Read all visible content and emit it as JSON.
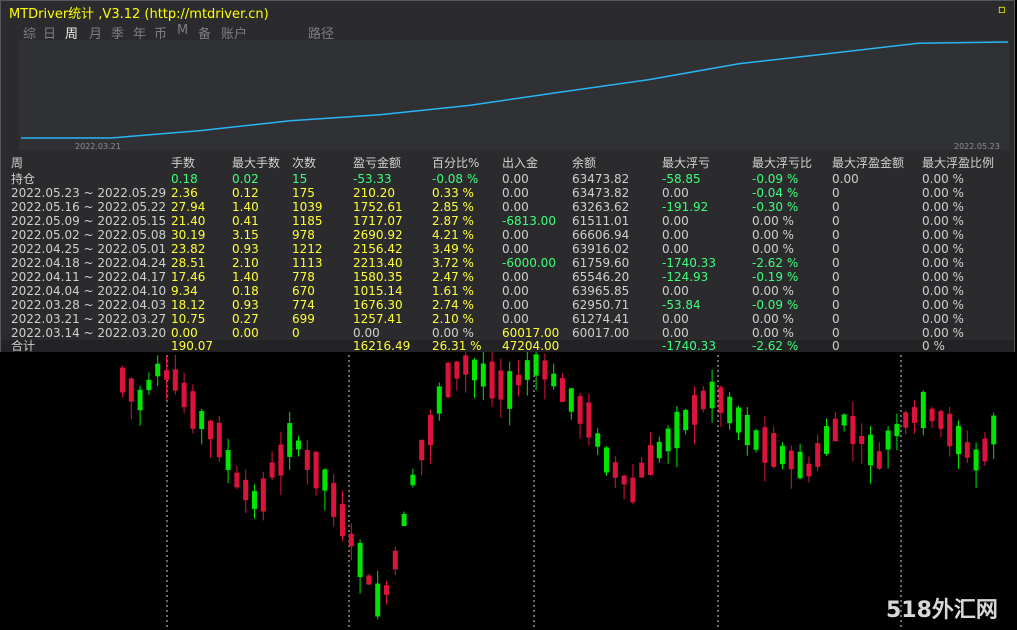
{
  "window": {
    "title": "MTDriver统计 ,V3.12 (http://mtdriver.cn)",
    "title_color": "#ffff00"
  },
  "tabs": [
    {
      "label": "综",
      "active": false
    },
    {
      "label": "日",
      "active": false
    },
    {
      "label": "周",
      "active": true
    },
    {
      "label": "月",
      "active": false
    },
    {
      "label": "季",
      "active": false
    },
    {
      "label": "年",
      "active": false
    },
    {
      "label": "币",
      "active": false
    },
    {
      "label": "M",
      "active": false
    },
    {
      "label": "备",
      "active": false
    },
    {
      "label": "账户",
      "active": false
    },
    {
      "label": "路径",
      "active": false
    }
  ],
  "equity_chart": {
    "start_date": "2022.03.21",
    "end_date": "2022.05.23",
    "line_color": "#29b6f6"
  },
  "table": {
    "headers": [
      "周",
      "手数",
      "最大手数",
      "次数",
      "盈亏金额",
      "百分比%",
      "出入金",
      "余额",
      "最大浮亏",
      "最大浮亏比",
      "最大浮盈金额",
      "最大浮盈比例"
    ],
    "rows": [
      [
        "持仓",
        "0.18",
        "0.02",
        "15",
        "-53.33",
        "-0.08 %",
        "0.00",
        "63473.82",
        "-58.85",
        "-0.09 %",
        "0.00",
        "0.00 %"
      ],
      [
        "2022.05.23 ~ 2022.05.29",
        "2.36",
        "0.12",
        "175",
        "210.20",
        "0.33 %",
        "0.00",
        "63473.82",
        "0.00",
        "-0.04 %",
        "0",
        "0.00 %"
      ],
      [
        "2022.05.16 ~ 2022.05.22",
        "27.94",
        "1.40",
        "1039",
        "1752.61",
        "2.85 %",
        "0.00",
        "63263.62",
        "-191.92",
        "-0.30 %",
        "0",
        "0.00 %"
      ],
      [
        "2022.05.09 ~ 2022.05.15",
        "21.40",
        "0.41",
        "1185",
        "1717.07",
        "2.87 %",
        "-6813.00",
        "61511.01",
        "0.00",
        "0.00 %",
        "0",
        "0.00 %"
      ],
      [
        "2022.05.02 ~ 2022.05.08",
        "30.19",
        "3.15",
        "978",
        "2690.92",
        "4.21 %",
        "0.00",
        "66606.94",
        "0.00",
        "0.00 %",
        "0",
        "0.00 %"
      ],
      [
        "2022.04.25 ~ 2022.05.01",
        "23.82",
        "0.93",
        "1212",
        "2156.42",
        "3.49 %",
        "0.00",
        "63916.02",
        "0.00",
        "0.00 %",
        "0",
        "0.00 %"
      ],
      [
        "2022.04.18 ~ 2022.04.24",
        "28.51",
        "2.10",
        "1113",
        "2213.40",
        "3.72 %",
        "-6000.00",
        "61759.60",
        "-1740.33",
        "-2.62 %",
        "0",
        "0.00 %"
      ],
      [
        "2022.04.11 ~ 2022.04.17",
        "17.46",
        "1.40",
        "778",
        "1580.35",
        "2.47 %",
        "0.00",
        "65546.20",
        "-124.93",
        "-0.19 %",
        "0",
        "0.00 %"
      ],
      [
        "2022.04.04 ~ 2022.04.10",
        "9.34",
        "0.18",
        "670",
        "1015.14",
        "1.61 %",
        "0.00",
        "63965.85",
        "0.00",
        "0.00 %",
        "0",
        "0.00 %"
      ],
      [
        "2022.03.28 ~ 2022.04.03",
        "18.12",
        "0.93",
        "774",
        "1676.30",
        "2.74 %",
        "0.00",
        "62950.71",
        "-53.84",
        "-0.09 %",
        "0",
        "0.00 %"
      ],
      [
        "2022.03.21 ~ 2022.03.27",
        "10.75",
        "0.27",
        "699",
        "1257.41",
        "2.10 %",
        "0.00",
        "61274.41",
        "0.00",
        "0.00 %",
        "0",
        "0.00 %"
      ],
      [
        "2022.03.14 ~ 2022.03.20",
        "0.00",
        "0.00",
        "0",
        "0.00",
        "0.00 %",
        "60017.00",
        "60017.00",
        "0.00",
        "0.00 %",
        "0",
        "0.00 %"
      ]
    ],
    "totals": [
      "合计",
      "190.07",
      "",
      "",
      "16216.49",
      "26.31 %",
      "47204.00",
      "",
      "-1740.33",
      "-2.62 %",
      "0",
      "0 %"
    ]
  },
  "colors": {
    "positive": "#ffff3a",
    "negative": "#3dff7a",
    "neutral": "#cfcfcf",
    "candle_up": "#00e600",
    "candle_down": "#dc143c"
  },
  "watermark": "518外汇网"
}
